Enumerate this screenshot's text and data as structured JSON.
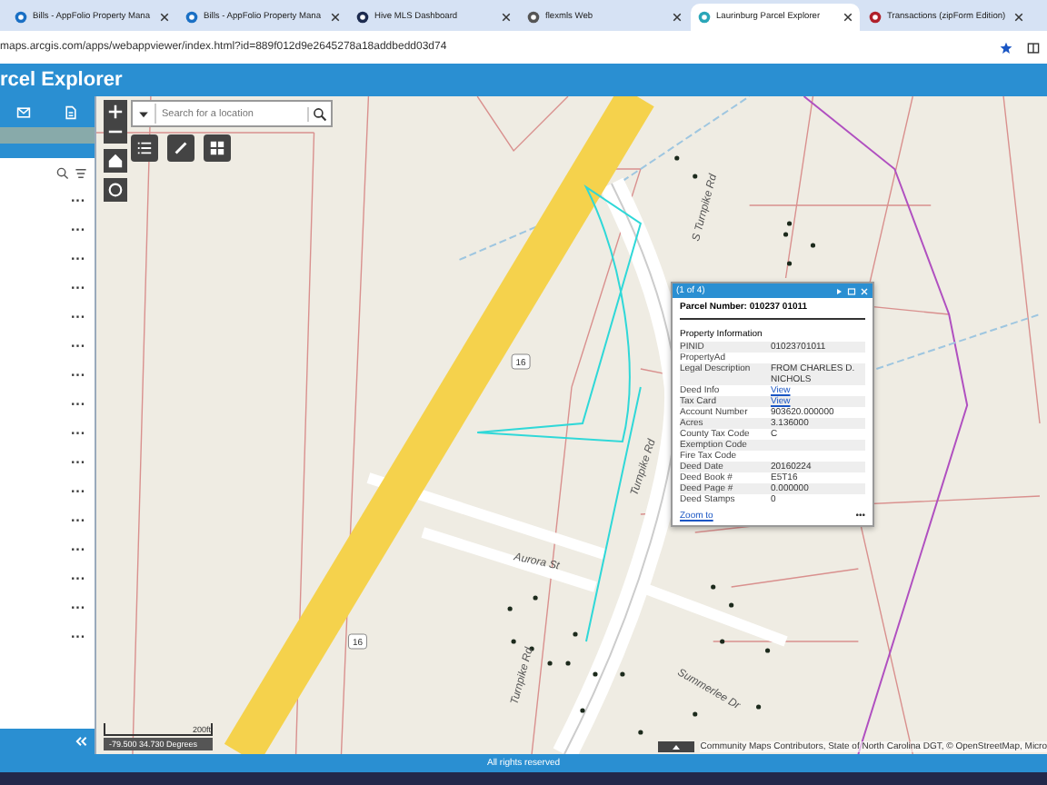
{
  "browser": {
    "tabs": [
      {
        "title": "Bills - AppFolio Property Mana",
        "selected": false,
        "kind": "appfolio"
      },
      {
        "title": "Bills - AppFolio Property Mana",
        "selected": false,
        "kind": "appfolio"
      },
      {
        "title": "Hive MLS Dashboard",
        "selected": false,
        "kind": "hive"
      },
      {
        "title": "flexmls Web",
        "selected": false,
        "kind": "flex"
      },
      {
        "title": "Laurinburg Parcel Explorer",
        "selected": true,
        "kind": "arcgis"
      },
      {
        "title": "Transactions (zipForm Edition)",
        "selected": false,
        "kind": "zipform"
      }
    ],
    "url": "maps.arcgis.com/apps/webappviewer/index.html?id=889f012d9e2645278a18addbedd03d74",
    "bookmarked": true
  },
  "app": {
    "title": "rcel Explorer"
  },
  "sidebar": {
    "rows": [
      {
        "menu": "···"
      },
      {
        "menu": "···"
      },
      {
        "menu": "···"
      },
      {
        "menu": "···"
      },
      {
        "menu": "···"
      },
      {
        "menu": "···"
      },
      {
        "menu": "···"
      },
      {
        "menu": "···"
      },
      {
        "menu": "···"
      },
      {
        "menu": "···"
      },
      {
        "menu": "···"
      },
      {
        "menu": "···"
      },
      {
        "menu": "···"
      },
      {
        "menu": "···"
      },
      {
        "menu": "···"
      },
      {
        "menu": "···"
      }
    ]
  },
  "search": {
    "placeholder": "Search for a location"
  },
  "map": {
    "labels": [
      {
        "text": "Aurora St",
        "kind": "street"
      },
      {
        "text": "Turnpike Rd",
        "kind": "street"
      },
      {
        "text": "Turnpike Rd",
        "kind": "street"
      },
      {
        "text": "Summerlee Dr",
        "kind": "street"
      },
      {
        "text": "S Turnpike Rd",
        "kind": "street"
      },
      {
        "text": "16",
        "kind": "shield"
      },
      {
        "text": "16",
        "kind": "shield"
      }
    ],
    "scale": "200ft",
    "coordinates": "-79.500 34.730 Degrees",
    "attribution": "Community Maps Contributors, State of North Carolina DGT, © OpenStreetMap, Micro"
  },
  "popup": {
    "counter": "(1 of 4)",
    "title": "Parcel Number: 010237 01011",
    "section": "Property Information",
    "rows": [
      {
        "label": "PINID",
        "value": "01023701011"
      },
      {
        "label": "PropertyAd"
      },
      {
        "label": "Legal Description",
        "value": "FROM CHARLES D. NICHOLS"
      },
      {
        "label": "Deed Info",
        "value": "View",
        "kind": "link"
      },
      {
        "label": "Tax Card",
        "value": "View",
        "kind": "link"
      },
      {
        "label": "Account Number",
        "value": "903620.000000"
      },
      {
        "label": "Acres",
        "value": "3.136000"
      },
      {
        "label": "County Tax Code",
        "value": "C"
      },
      {
        "label": "Exemption Code"
      },
      {
        "label": "Fire Tax Code"
      },
      {
        "label": "Deed Date",
        "value": "20160224"
      },
      {
        "label": "Deed Book #",
        "value": "E5T16"
      },
      {
        "label": "Deed Page #",
        "value": "0.000000"
      },
      {
        "label": "Deed Stamps",
        "value": "0"
      }
    ],
    "zoom_link": "Zoom to",
    "more": "•••"
  },
  "footer": {
    "text": "All rights reserved"
  }
}
